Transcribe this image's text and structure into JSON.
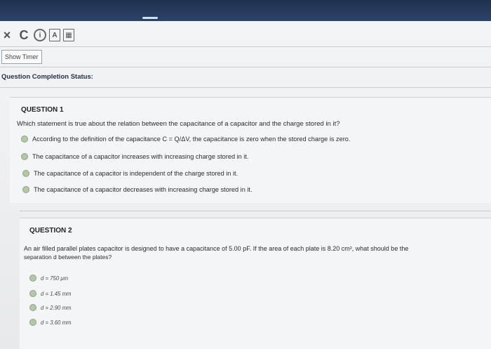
{
  "toolbar": {
    "close_glyph": "×",
    "refresh_glyph": "C",
    "info_glyph": "i",
    "doc_glyph": "A",
    "calc_glyph": "▦"
  },
  "timer": {
    "label": "Show Timer"
  },
  "status": {
    "label": "Question Completion Status:"
  },
  "questions": [
    {
      "heading": "QUESTION 1",
      "prompt": "Which statement is true about the relation between the capacitance of a capacitor and the charge stored in it?",
      "options": [
        "According to the definition of the capacitance C = Q/ΔV, the capacitance is zero when the stored charge is zero.",
        "The capacitance of a capacitor increases with increasing charge stored in it.",
        "The capacitance of a capacitor is independent of the charge stored in it.",
        "The capacitance of a capacitor decreases with increasing charge stored in it."
      ]
    },
    {
      "heading": "QUESTION 2",
      "prompt_line1": "An air filled parallel plates capacitor is designed to have a capacitance of 5.00 pF. If the area of each plate is 8.20 cm², what should be the",
      "prompt_line2": "separation d between the plates?",
      "options": [
        "d = 750 μm",
        "d = 1.45 mm",
        "d = 2.90 mm",
        "d = 3.60 mm"
      ]
    }
  ]
}
